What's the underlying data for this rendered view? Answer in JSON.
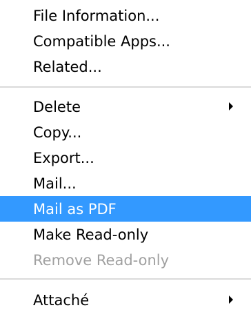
{
  "menu": {
    "groups": [
      [
        {
          "label": "File Information..."
        },
        {
          "label": "Compatible Apps..."
        },
        {
          "label": "Related..."
        }
      ],
      [
        {
          "label": "Delete",
          "submenu": true
        },
        {
          "label": "Copy..."
        },
        {
          "label": "Export..."
        },
        {
          "label": "Mail..."
        },
        {
          "label": "Mail as PDF",
          "state": "selected"
        },
        {
          "label": "Make Read-only"
        },
        {
          "label": "Remove Read-only",
          "state": "disabled"
        }
      ],
      [
        {
          "label": "Attaché",
          "submenu": true
        }
      ]
    ],
    "colors": {
      "highlight": "#3399ff",
      "highlight_text": "#ffffff",
      "disabled_text": "#a0a0a0",
      "separator": "#dadada"
    },
    "icons": {
      "submenu": "chevron-right-icon"
    }
  }
}
